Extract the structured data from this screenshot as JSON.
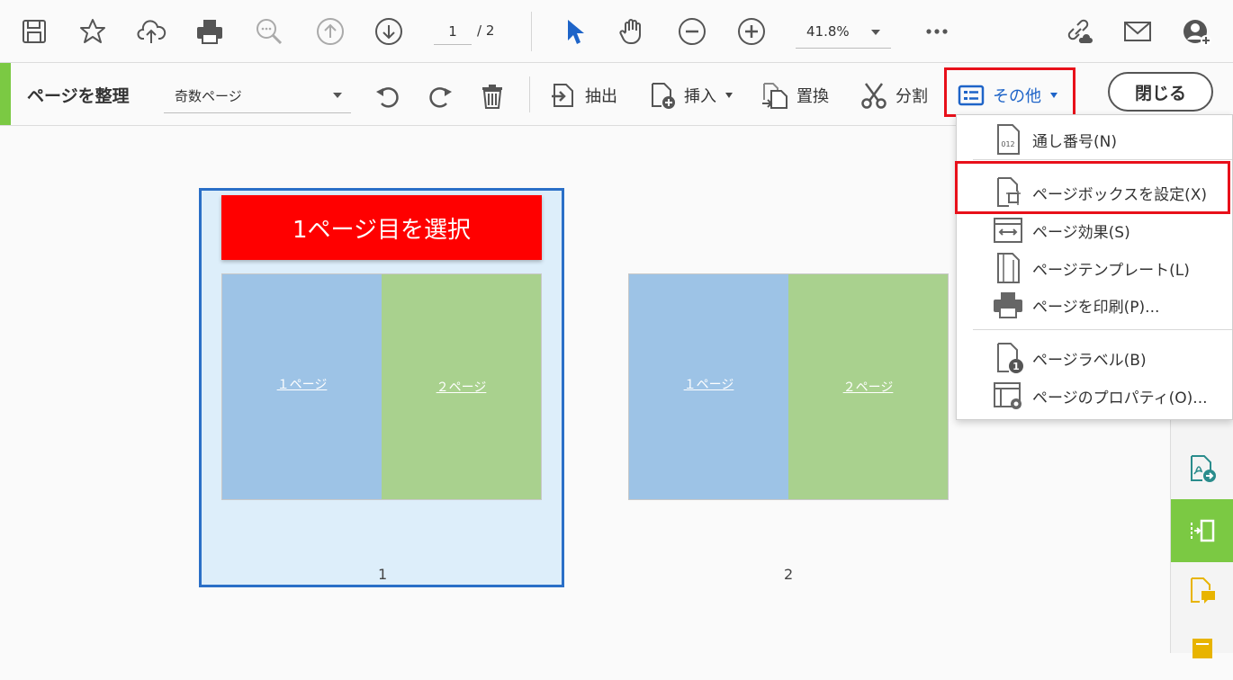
{
  "toolbar": {
    "page_current": "1",
    "page_total": "/ 2",
    "zoom": "41.8%",
    "icons": [
      "save-icon",
      "bookmark-star-icon",
      "cloud-upload-icon",
      "print-icon",
      "zoom-search-icon",
      "prev-page-icon",
      "next-page-icon",
      "select-arrow-icon",
      "hand-tool-icon",
      "zoom-out-icon",
      "zoom-in-icon",
      "more-icon",
      "share-link-icon",
      "mail-icon",
      "add-user-icon"
    ]
  },
  "organize": {
    "title": "ページを整理",
    "page_filter": "奇数ページ",
    "extract_label": "抽出",
    "insert_label": "挿入",
    "replace_label": "置換",
    "split_label": "分割",
    "more_label": "その他",
    "close_label": "閉じる"
  },
  "pages": {
    "callout": "1ページ目を選択",
    "left_half_label": "１ページ",
    "right_half_label": "２ページ",
    "thumb1_number": "1",
    "thumb2_number": "2"
  },
  "menu": {
    "items": [
      {
        "label": "通し番号(N)",
        "icon": "bates-number-icon"
      },
      {
        "label": "ページボックスを設定(X)",
        "icon": "set-page-box-icon"
      },
      {
        "label": "ページ効果(S)",
        "icon": "page-transition-icon"
      },
      {
        "label": "ページテンプレート(L)",
        "icon": "page-template-icon"
      },
      {
        "label": "ページを印刷(P)...",
        "icon": "print-page-icon"
      },
      {
        "label": "ページラベル(B)",
        "icon": "page-label-icon"
      },
      {
        "label": "ページのプロパティ(O)...",
        "icon": "page-properties-icon"
      }
    ]
  },
  "colors": {
    "accent_green": "#7bc943",
    "accent_blue": "#1e64c8",
    "highlight_red": "#e8101a",
    "callout_red": "#ff0000",
    "page_blue": "#9dc3e6",
    "page_green": "#a9d18e",
    "selection_blue": "#2a6fc7"
  }
}
